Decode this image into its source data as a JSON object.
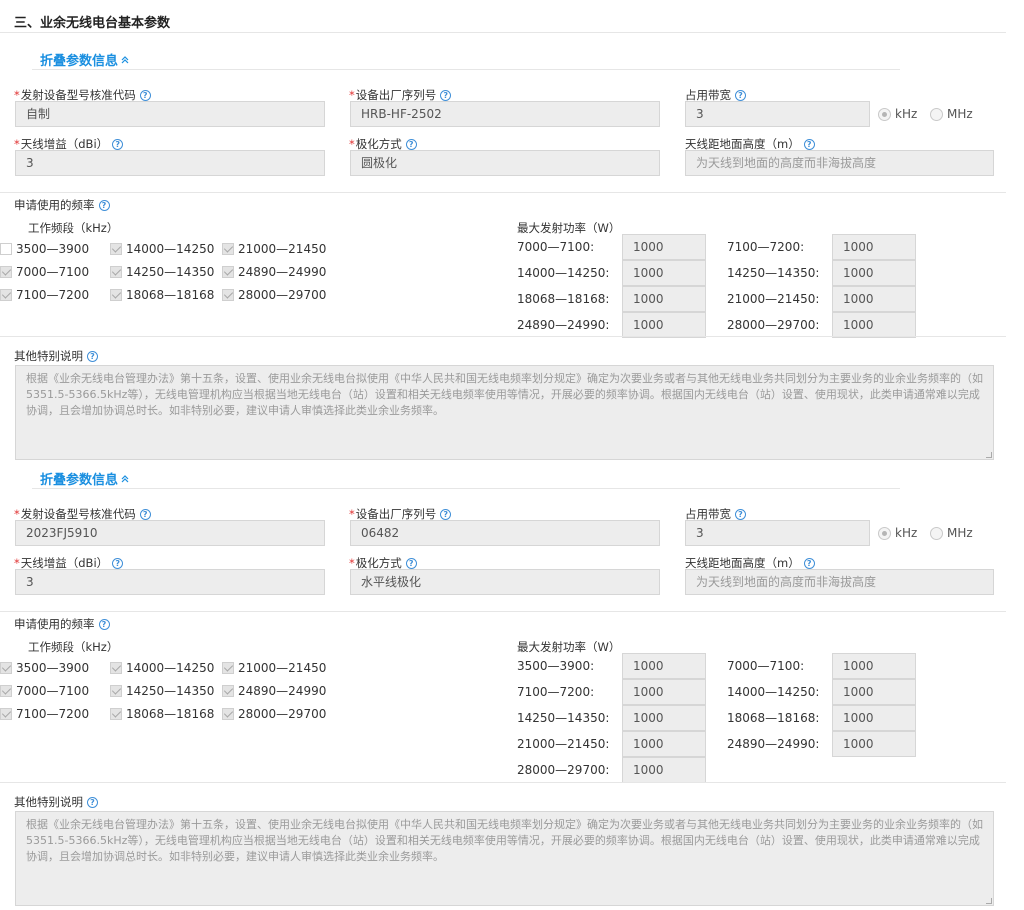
{
  "section_title": "三、业余无线电台基本参数",
  "blocks": [
    {
      "fold_title": "折叠参数信息",
      "model_code": {
        "label": "发射设备型号核准代码",
        "value": "自制"
      },
      "serial": {
        "label": "设备出厂序列号",
        "value": "HRB-HF-2502"
      },
      "bandwidth": {
        "label": "占用带宽",
        "value": "3",
        "unit_khz": "kHz",
        "unit_mhz": "MHz"
      },
      "gain": {
        "label": "天线增益（dBi）",
        "value": "3"
      },
      "polarization": {
        "label": "极化方式",
        "value": "圆极化"
      },
      "height": {
        "label": "天线距地面高度（m）",
        "placeholder": "为天线到地面的高度而非海拔高度"
      },
      "freq_title": "申请使用的频率",
      "band_header": "工作频段（kHz）",
      "power_header": "最大发射功率（W）",
      "bands": [
        {
          "label": "3500—3900",
          "checked": false
        },
        {
          "label": "14000—14250",
          "checked": true
        },
        {
          "label": "21000—21450",
          "checked": true
        },
        {
          "label": "7000—7100",
          "checked": true
        },
        {
          "label": "14250—14350",
          "checked": true
        },
        {
          "label": "24890—24990",
          "checked": true
        },
        {
          "label": "7100—7200",
          "checked": true
        },
        {
          "label": "18068—18168",
          "checked": true
        },
        {
          "label": "28000—29700",
          "checked": true
        }
      ],
      "powers": [
        {
          "label": "7000—7100:",
          "value": "1000"
        },
        {
          "label": "7100—7200:",
          "value": "1000"
        },
        {
          "label": "14000—14250:",
          "value": "1000"
        },
        {
          "label": "14250—14350:",
          "value": "1000"
        },
        {
          "label": "18068—18168:",
          "value": "1000"
        },
        {
          "label": "21000—21450:",
          "value": "1000"
        },
        {
          "label": "24890—24990:",
          "value": "1000"
        },
        {
          "label": "28000—29700:",
          "value": "1000"
        }
      ],
      "notes_label": "其他特别说明",
      "notes_text": "根据《业余无线电台管理办法》第十五条，设置、使用业余无线电台拟使用《中华人民共和国无线电频率划分规定》确定为次要业务或者与其他无线电业务共同划分为主要业务的业余业务频率的（如5351.5-5366.5kHz等），无线电管理机构应当根据当地无线电台（站）设置和相关无线电频率使用等情况，开展必要的频率协调。根据国内无线电台（站）设置、使用现状，此类申请通常难以完成协调，且会增加协调总时长。如非特别必要，建议申请人审慎选择此类业余业务频率。"
    },
    {
      "fold_title": "折叠参数信息",
      "model_code": {
        "label": "发射设备型号核准代码",
        "value": "2023FJ5910"
      },
      "serial": {
        "label": "设备出厂序列号",
        "value": "06482"
      },
      "bandwidth": {
        "label": "占用带宽",
        "value": "3",
        "unit_khz": "kHz",
        "unit_mhz": "MHz"
      },
      "gain": {
        "label": "天线增益（dBi）",
        "value": "3"
      },
      "polarization": {
        "label": "极化方式",
        "value": "水平线极化"
      },
      "height": {
        "label": "天线距地面高度（m）",
        "placeholder": "为天线到地面的高度而非海拔高度"
      },
      "freq_title": "申请使用的频率",
      "band_header": "工作频段（kHz）",
      "power_header": "最大发射功率（W）",
      "bands": [
        {
          "label": "3500—3900",
          "checked": true
        },
        {
          "label": "14000—14250",
          "checked": true
        },
        {
          "label": "21000—21450",
          "checked": true
        },
        {
          "label": "7000—7100",
          "checked": true
        },
        {
          "label": "14250—14350",
          "checked": true
        },
        {
          "label": "24890—24990",
          "checked": true
        },
        {
          "label": "7100—7200",
          "checked": true
        },
        {
          "label": "18068—18168",
          "checked": true
        },
        {
          "label": "28000—29700",
          "checked": true
        }
      ],
      "powers": [
        {
          "label": "3500—3900:",
          "value": "1000"
        },
        {
          "label": "7000—7100:",
          "value": "1000"
        },
        {
          "label": "7100—7200:",
          "value": "1000"
        },
        {
          "label": "14000—14250:",
          "value": "1000"
        },
        {
          "label": "14250—14350:",
          "value": "1000"
        },
        {
          "label": "18068—18168:",
          "value": "1000"
        },
        {
          "label": "21000—21450:",
          "value": "1000"
        },
        {
          "label": "24890—24990:",
          "value": "1000"
        },
        {
          "label": "28000—29700:",
          "value": "1000"
        }
      ],
      "notes_label": "其他特别说明",
      "notes_text": "根据《业余无线电台管理办法》第十五条，设置、使用业余无线电台拟使用《中华人民共和国无线电频率划分规定》确定为次要业务或者与其他无线电业务共同划分为主要业务的业余业务频率的（如5351.5-5366.5kHz等），无线电管理机构应当根据当地无线电台（站）设置和相关无线电频率使用等情况，开展必要的频率协调。根据国内无线电台（站）设置、使用现状，此类申请通常难以完成协调，且会增加协调总时长。如非特别必要，建议申请人审慎选择此类业余业务频率。"
    }
  ]
}
